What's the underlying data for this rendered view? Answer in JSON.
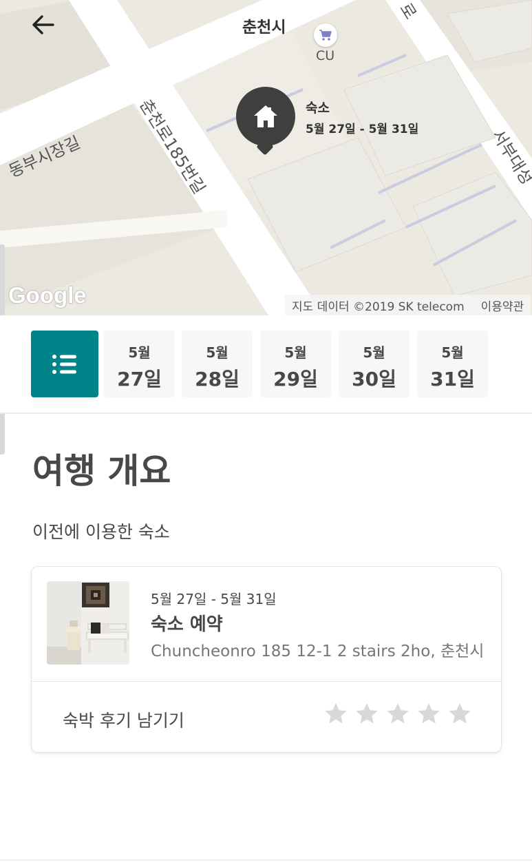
{
  "map": {
    "city_label": "춘천시",
    "poi_label": "CU",
    "road_labels": [
      "동부시장길",
      "춘천로185번길",
      "서부대성",
      "로"
    ],
    "pin": {
      "title": "숙소",
      "dates": "5월 27일 - 5월 31일"
    },
    "google_logo": "Google",
    "attribution": "지도 데이터 ©2019 SK telecom",
    "terms": "이용약관"
  },
  "date_strip": {
    "days": [
      {
        "month": "5월",
        "date": "27일"
      },
      {
        "month": "5월",
        "date": "28일"
      },
      {
        "month": "5월",
        "date": "29일"
      },
      {
        "month": "5월",
        "date": "30일"
      },
      {
        "month": "5월",
        "date": "31일"
      }
    ]
  },
  "main": {
    "title": "여행 개요",
    "section_label": "이전에 이용한 숙소",
    "card": {
      "dates": "5월 27일 - 5월 31일",
      "title": "숙소 예약",
      "address": "Chuncheonro 185 12-1 2 stairs 2ho, 춘천시",
      "review_label": "숙박 후기 남기기",
      "rating": 0,
      "max_rating": 5
    }
  },
  "colors": {
    "accent": "#008489",
    "pin": "#3f3f3f",
    "star_empty": "#d8d8d8"
  },
  "icons": [
    "back-arrow-icon",
    "cart-icon",
    "home-icon",
    "list-icon",
    "star-icon"
  ]
}
